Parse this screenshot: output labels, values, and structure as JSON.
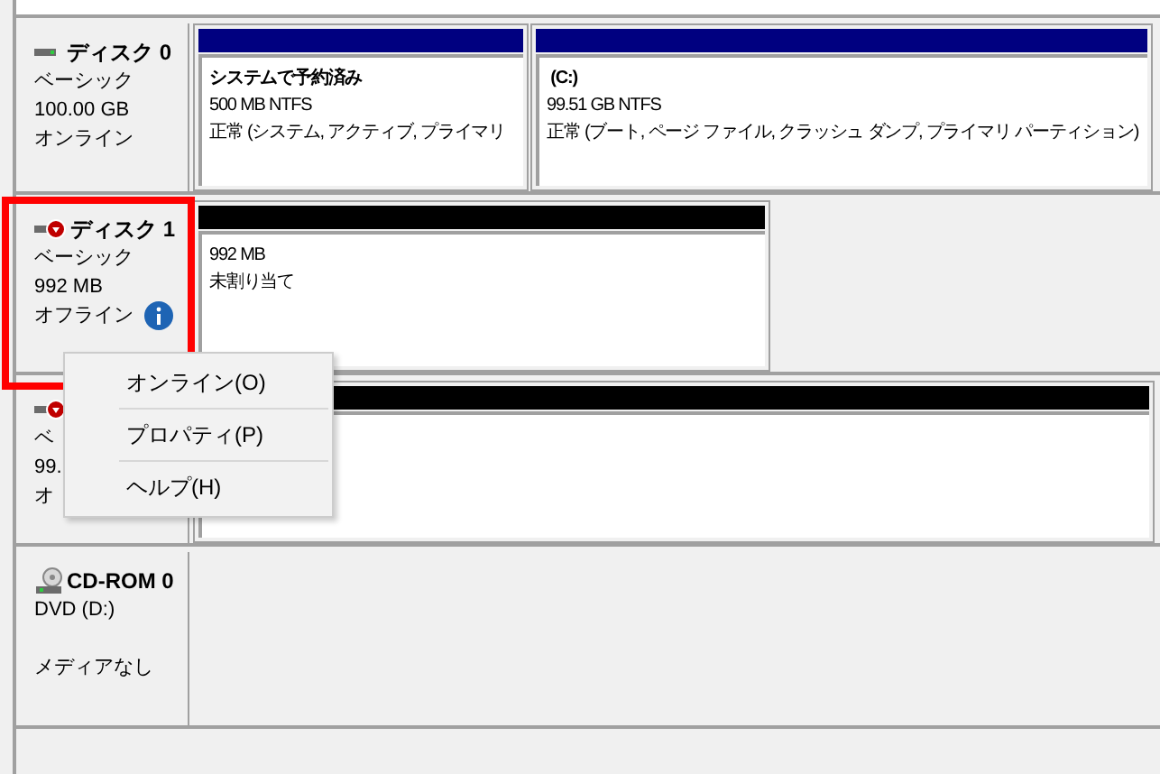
{
  "disks": [
    {
      "kind": "disk",
      "name": "ディスク 0",
      "lines": [
        "ベーシック",
        "100.00 GB",
        "オンライン"
      ],
      "offline": false,
      "partitions": [
        {
          "allocated": true,
          "lines": [
            "システムで予約済み",
            "500 MB NTFS",
            "正常 (システム, アクティブ, プライマリ"
          ]
        },
        {
          "allocated": true,
          "lines": [
            " (C:)",
            "99.51 GB NTFS",
            "正常 (ブート, ページ ファイル, クラッシュ ダンプ, プライマリ パーティション)"
          ]
        }
      ]
    },
    {
      "kind": "disk",
      "name": "ディスク 1",
      "lines": [
        "ベーシック",
        "992 MB",
        "オフライン"
      ],
      "offline": true,
      "partitions": [
        {
          "allocated": false,
          "lines": [
            "992 MB",
            "未割り当て"
          ]
        }
      ]
    },
    {
      "kind": "disk",
      "lines": [
        "ベ",
        "99.",
        "オ"
      ],
      "offline": true,
      "partitions": [
        {
          "allocated": false
        }
      ]
    },
    {
      "kind": "cdrom",
      "name": "CD-ROM 0",
      "lines": [
        "DVD (D:)"
      ],
      "note": "メディアなし"
    }
  ],
  "context_menu": {
    "items": [
      "オンライン(O)",
      "プロパティ(P)",
      "ヘルプ(H)"
    ]
  }
}
